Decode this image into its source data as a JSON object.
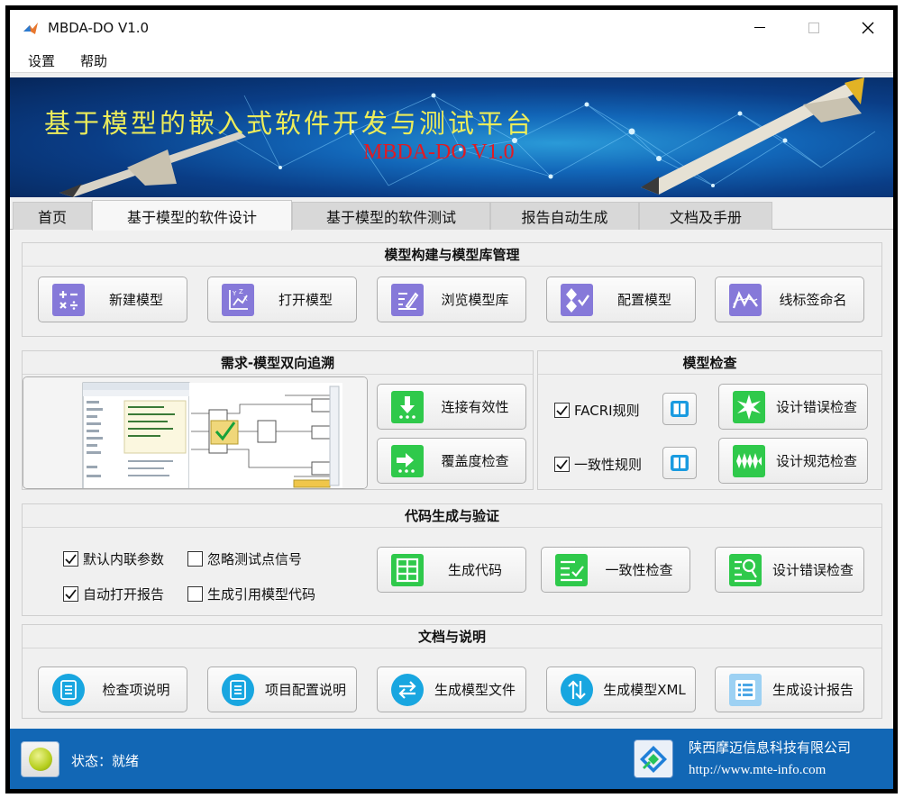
{
  "window": {
    "title": "MBDA-DO V1.0"
  },
  "menu": [
    "设置",
    "帮助"
  ],
  "banner": {
    "title": "基于模型的嵌入式软件开发与测试平台",
    "subtitle": "MBDA-DO V1.0"
  },
  "tabs": [
    "首页",
    "基于模型的软件设计",
    "基于模型的软件测试",
    "报告自动生成",
    "文档及手册"
  ],
  "active_tab": 1,
  "model_lib": {
    "title": "模型构建与模型库管理",
    "buttons": [
      "新建模型",
      "打开模型",
      "浏览模型库",
      "配置模型",
      "线标签命名"
    ]
  },
  "trace": {
    "title": "需求-模型双向追溯",
    "buttons": [
      "连接有效性",
      "覆盖度检查"
    ]
  },
  "check": {
    "title": "模型检查",
    "rules": [
      {
        "label": "FACRI规则",
        "checked": true
      },
      {
        "label": "一致性规则",
        "checked": true
      }
    ],
    "buttons": [
      "设计错误检查",
      "设计规范检查"
    ]
  },
  "codegen": {
    "title": "代码生成与验证",
    "options": [
      {
        "label": "默认内联参数",
        "checked": true
      },
      {
        "label": "忽略测试点信号",
        "checked": false
      },
      {
        "label": "自动打开报告",
        "checked": true
      },
      {
        "label": "生成引用模型代码",
        "checked": false
      }
    ],
    "buttons": [
      "生成代码",
      "一致性检查",
      "设计错误检查"
    ]
  },
  "docs": {
    "title": "文档与说明",
    "buttons": [
      "检查项说明",
      "项目配置说明",
      "生成模型文件",
      "生成模型XML",
      "生成设计报告"
    ]
  },
  "status": {
    "label": "状态：就绪",
    "company": "陕西摩迈信息科技有限公司",
    "url": "http://www.mte-info.com",
    "led_color": "#b7cf1f"
  },
  "colors": {
    "status_bar": "#1267b5",
    "purple_icon": "#8679d9",
    "green_icon": "#2fc94b",
    "blue_icon": "#18a6e0"
  }
}
